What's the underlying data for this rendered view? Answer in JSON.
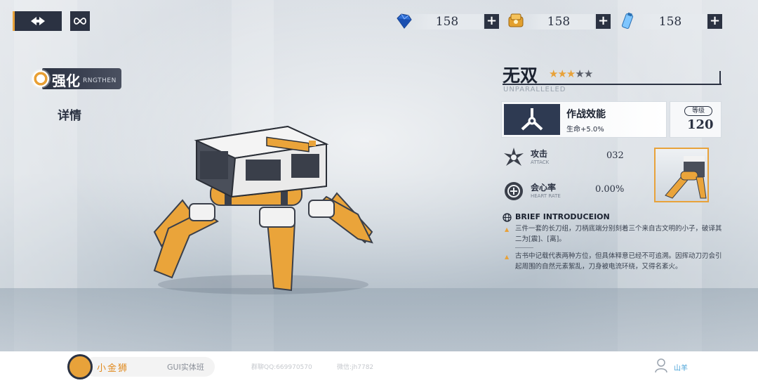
{
  "resources": [
    {
      "icon": "blue-crystal-icon",
      "value": "158",
      "add": "+"
    },
    {
      "icon": "gold-coin-icon",
      "value": "158",
      "add": "+"
    },
    {
      "icon": "energy-bottle-icon",
      "value": "158",
      "add": "+"
    }
  ],
  "nav": {
    "enhance_tab": {
      "label": "强化",
      "sublabel": "RNGTHEN"
    },
    "detail_tab": {
      "label": "详情"
    }
  },
  "weapon": {
    "name": "无双",
    "subtitle": "UNPARALLELED",
    "stars_filled": 3,
    "stars_total": 5,
    "star_glyph": "★"
  },
  "skill": {
    "name": "作战效能",
    "effect": "生命+5.0%"
  },
  "level": {
    "label": "等级",
    "value": "120"
  },
  "stats": [
    {
      "name": "攻击",
      "en": "ATTACK",
      "value": "032",
      "icon": "attack-icon"
    },
    {
      "name": "会心率",
      "en": "HEART RATE",
      "value": "0.00%",
      "icon": "crit-rate-icon"
    }
  ],
  "intro": {
    "heading": "BRIEF INTRODUCEION",
    "paragraphs": [
      "三件一套的长刀组，刀柄底端分别刻着三个来自古文明的小子，破译其二为[震]、[离]。",
      "古书中记载代表两种方位，但具体释意已经不可追溯。因挥动刀刃会引起周围的自然元素絮乱，刀身被电流环绕，又得名紊火。"
    ]
  },
  "footer": {
    "brand": "小金狮",
    "course": "GUI实体班",
    "qq": "群聊QQ:669970570",
    "wechat": "微信:jh7782",
    "user": "山羊"
  },
  "colors": {
    "accent": "#e8a23a",
    "dark": "#2b3242",
    "footer_brand": "#e08a1e",
    "footer_user": "#4aa3d8"
  }
}
